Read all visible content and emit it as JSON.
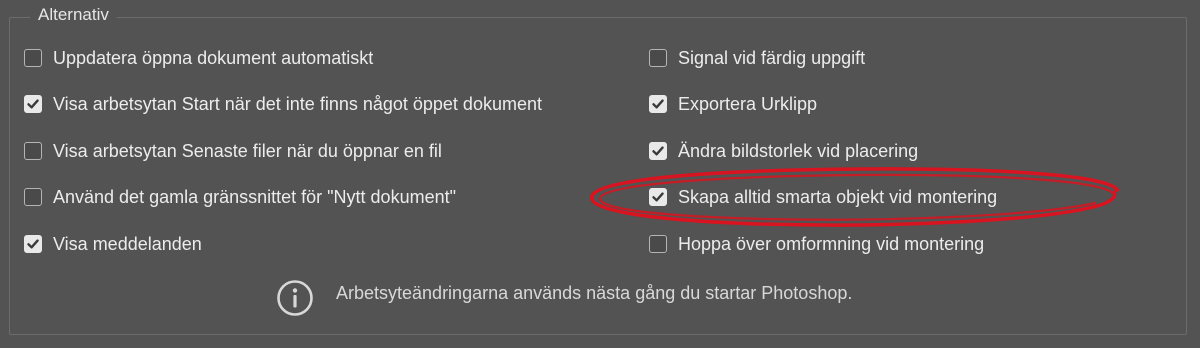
{
  "group": {
    "title": "Alternativ"
  },
  "options_left": [
    {
      "label": "Uppdatera öppna dokument automatiskt",
      "checked": false
    },
    {
      "label": "Visa arbetsytan Start när det inte finns något öppet dokument",
      "checked": true
    },
    {
      "label": "Visa arbetsytan Senaste filer när du öppnar en fil",
      "checked": false
    },
    {
      "label": "Använd det gamla gränssnittet för \"Nytt dokument\"",
      "checked": false
    },
    {
      "label": "Visa meddelanden",
      "checked": true
    }
  ],
  "options_right": [
    {
      "label": "Signal vid färdig uppgift",
      "checked": false
    },
    {
      "label": "Exportera Urklipp",
      "checked": true
    },
    {
      "label": "Ändra bildstorlek vid placering",
      "checked": true
    },
    {
      "label": "Skapa alltid smarta objekt vid montering",
      "checked": true
    },
    {
      "label": "Hoppa över omformning vid montering",
      "checked": false
    }
  ],
  "info": {
    "icon": "info-icon",
    "text": "Arbetsyteändringarna används nästa gång du startar Photoshop."
  },
  "colors": {
    "panel_background": "#535353",
    "text": "#ececec",
    "checkbox_checked": "#e9e9e9",
    "annotation_red": "#d9131f"
  }
}
